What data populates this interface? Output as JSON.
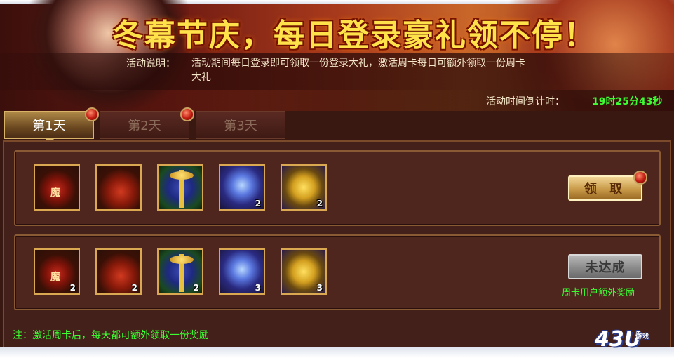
{
  "banner": {
    "title": "冬幕节庆，每日登录豪礼领不停！",
    "desc_label": "活动说明：",
    "desc_text": "活动期间每日登录即可领取一份登录大礼，激活周卡每日可额外领取一份周卡大礼",
    "timer_label": "活动时间倒计时：",
    "timer_value": "19时25分43秒"
  },
  "tabs": [
    {
      "label": "第1天",
      "active": true
    },
    {
      "label": "第2天",
      "active": false
    },
    {
      "label": "第3天",
      "active": false
    }
  ],
  "rows": [
    {
      "items": [
        {
          "icon": "magic-bag-icon",
          "count": ""
        },
        {
          "icon": "red-gourd-icon",
          "count": ""
        },
        {
          "icon": "gift-box-icon",
          "count": ""
        },
        {
          "icon": "crystal-icon",
          "count": "2"
        },
        {
          "icon": "gold-ingot-icon",
          "count": "2"
        }
      ],
      "button_label": "领 取"
    },
    {
      "items": [
        {
          "icon": "magic-bag-icon",
          "count": "2"
        },
        {
          "icon": "red-gourd-icon",
          "count": "2"
        },
        {
          "icon": "gift-box-icon",
          "count": "2"
        },
        {
          "icon": "crystal-icon",
          "count": "3"
        },
        {
          "icon": "gold-ingot-icon",
          "count": "3"
        }
      ],
      "button_label": "未达成",
      "note": "周卡用户额外奖励"
    }
  ],
  "footer_note": "注：激活周卡后，每天都可额外领取一份奖励",
  "logo": {
    "main": "43U",
    "sub": "游戏"
  }
}
